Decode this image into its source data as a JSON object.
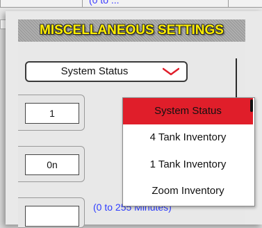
{
  "background": {
    "partial_link": "(0 to ..."
  },
  "dialog": {
    "title": "MISCELLANEOUS SETTINGS",
    "title_color": "#ffee00"
  },
  "select": {
    "value": "System Status",
    "icon": "chevron-down-icon",
    "icon_color": "#e01e2a"
  },
  "fields": [
    {
      "value": "1"
    },
    {
      "value": "0n"
    },
    {
      "value": ""
    }
  ],
  "range_text": "(0 to 255 Minutes)",
  "dropdown": {
    "options": [
      {
        "label": "System Status",
        "selected": true
      },
      {
        "label": "4 Tank Inventory",
        "selected": false
      },
      {
        "label": "1 Tank Inventory",
        "selected": false
      },
      {
        "label": "Zoom Inventory",
        "selected": false
      }
    ],
    "selected_color": "#e01e2a"
  }
}
